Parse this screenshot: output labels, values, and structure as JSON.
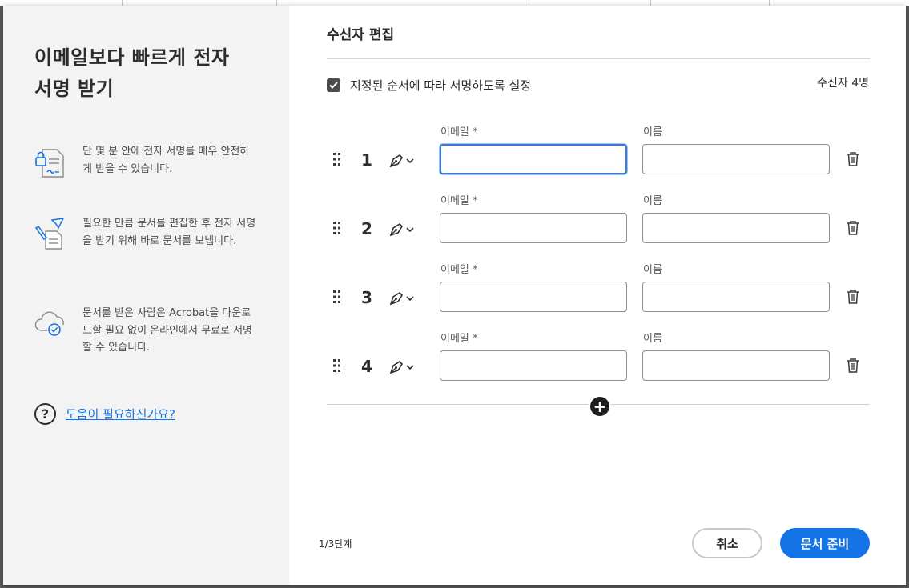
{
  "left_panel": {
    "title_line1": "이메일보다 빠르게 전자",
    "title_line2": "서명 받기",
    "features": [
      {
        "icon": "lock-document-icon",
        "text": "단 몇 분 안에 전자 서명를 매우 안전하게 받을 수 있습니다."
      },
      {
        "icon": "send-document-icon",
        "text": "필요한 만큼 문서를 편집한 후 전자 서명을 받기 위해 바로 문서를 보냅니다."
      },
      {
        "icon": "cloud-check-icon",
        "text": "문서를 받은 사람은 Acrobat을 다운로드할 필요 없이 온라인에서 무료로 서명할 수 있습니다."
      }
    ],
    "help_icon": "?",
    "help_link": "도움이 필요하신가요?"
  },
  "right_panel": {
    "title": "수신자 편집",
    "order_checkbox_label": "지정된 순서에 따라 서명하도록 설정",
    "order_checked": true,
    "recipient_count": "수신자 4명",
    "recipients": [
      {
        "number": "1",
        "email_label": "이메일 *",
        "name_label": "이름",
        "email_value": "",
        "name_value": ""
      },
      {
        "number": "2",
        "email_label": "이메일 *",
        "name_label": "이름",
        "email_value": "",
        "name_value": ""
      },
      {
        "number": "3",
        "email_label": "이메일 *",
        "name_label": "이름",
        "email_value": "",
        "name_value": ""
      },
      {
        "number": "4",
        "email_label": "이메일 *",
        "name_label": "이름",
        "email_value": "",
        "name_value": ""
      }
    ],
    "add_button": "+",
    "step": "1/3단계",
    "cancel_button": "취소",
    "primary_button": "문서 준비"
  },
  "colors": {
    "accent": "#1473e6",
    "left_bg": "#f3f3f3",
    "text": "#2c2c2c"
  }
}
